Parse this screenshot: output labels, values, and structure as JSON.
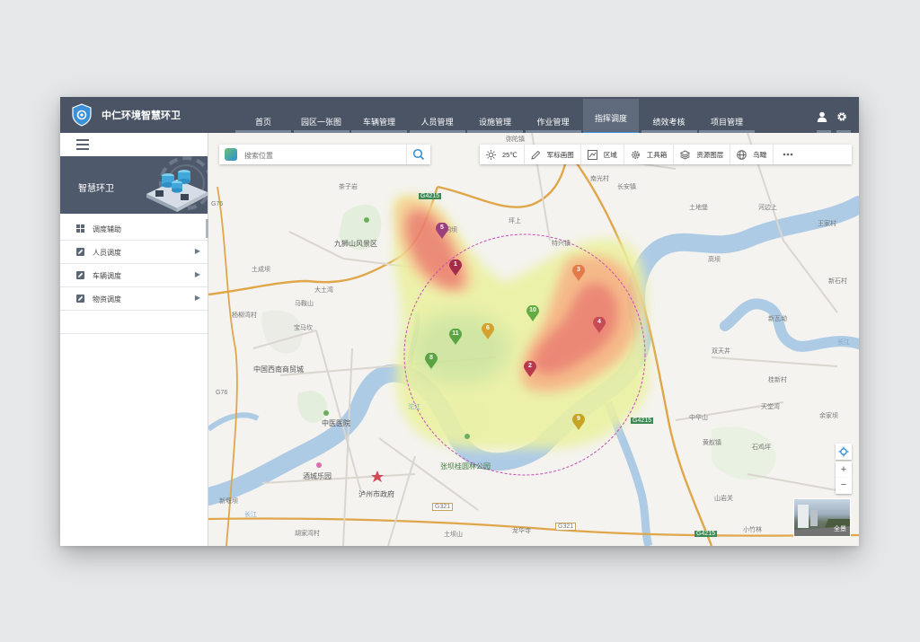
{
  "app": {
    "title": "中仁环境智慧环卫"
  },
  "nav": [
    {
      "label": "首页",
      "active": false
    },
    {
      "label": "园区一张图",
      "active": false
    },
    {
      "label": "车辆管理",
      "active": false
    },
    {
      "label": "人员管理",
      "active": false
    },
    {
      "label": "设施管理",
      "active": false
    },
    {
      "label": "作业管理",
      "active": false
    },
    {
      "label": "指挥调度",
      "active": true
    },
    {
      "label": "绩效考核",
      "active": false
    },
    {
      "label": "项目管理",
      "active": false
    }
  ],
  "sidebar": {
    "banner_title": "智慧环卫",
    "items": [
      {
        "label": "调度辅助",
        "icon": "grid-icon"
      },
      {
        "label": "人员调度",
        "icon": "edit-icon"
      },
      {
        "label": "车辆调度",
        "icon": "edit-icon"
      },
      {
        "label": "物资调度",
        "icon": "edit-icon"
      }
    ]
  },
  "search": {
    "placeholder": "搜索位置"
  },
  "toolbar": {
    "weather": "25℃",
    "items": [
      "军标画图",
      "区域",
      "工具箱",
      "资源图层",
      "鸟瞰"
    ]
  },
  "map": {
    "labels": [
      "龙洞坝",
      "G76",
      "G76",
      "九狮山风景区",
      "大土湾",
      "中国西南商贸城",
      "中医医院",
      "泸州市政府",
      "酒城乐园",
      "张坝桂圆林公园",
      "坪上",
      "G4215",
      "G4215",
      "G4215",
      "G321",
      "G321",
      "弥陀镇",
      "黄舣镇",
      "南光村",
      "长安镇",
      "长江",
      "长江",
      "沱江",
      "特兴镇",
      "土地堡",
      "河边上",
      "王家村",
      "新石村",
      "高坝",
      "双天井",
      "新瓦坳",
      "桂新村",
      "天堂湾",
      "余家坝",
      "中华山",
      "石鸡坪",
      "山岩关",
      "小竹林",
      "土坝山",
      "龙华寺",
      "宝马坎",
      "杨柳湾村",
      "胡家湾村",
      "茶子岩",
      "马鞍山",
      "土成坝",
      "新堰坝"
    ],
    "markers": [
      {
        "id": "1",
        "color": "#a52c49"
      },
      {
        "id": "2",
        "color": "#b63a4c"
      },
      {
        "id": "3",
        "color": "#e27a4a"
      },
      {
        "id": "4",
        "color": "#c84a56"
      },
      {
        "id": "5",
        "color": "#9c3f7d"
      },
      {
        "id": "6",
        "color": "#d5a22f"
      },
      {
        "id": "8",
        "color": "#5aa443"
      },
      {
        "id": "9",
        "color": "#c6a424"
      },
      {
        "id": "10",
        "color": "#64ab44"
      },
      {
        "id": "11",
        "color": "#5aa443"
      }
    ],
    "pano_label": "全景"
  }
}
